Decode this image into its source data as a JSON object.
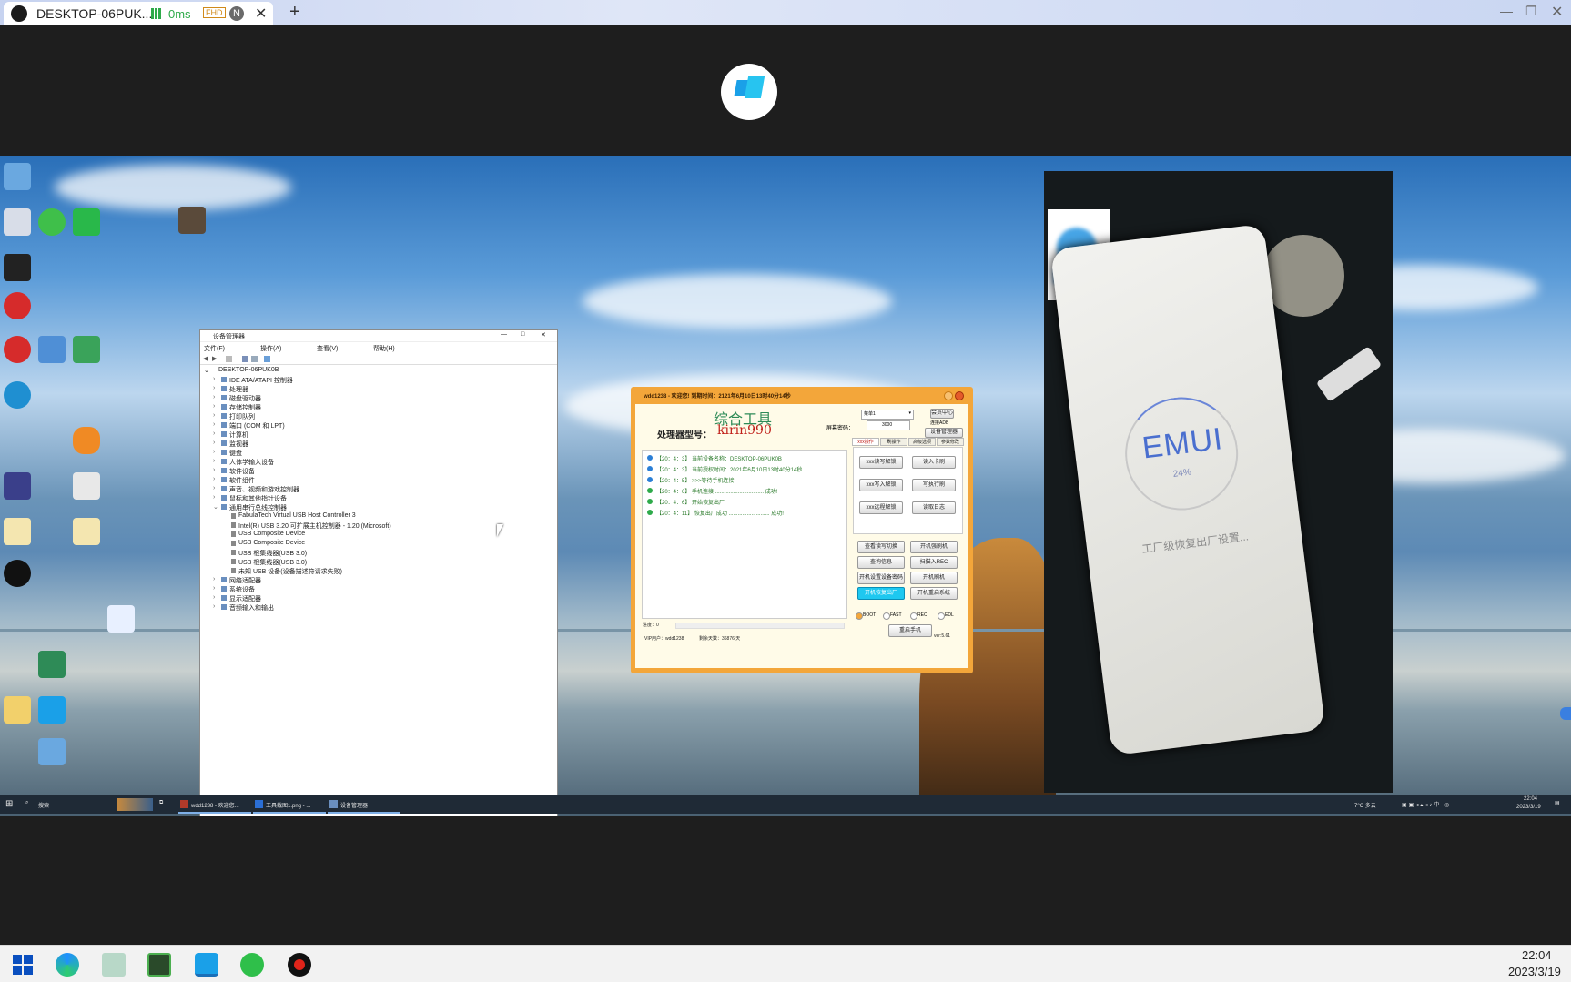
{
  "browser_tab": {
    "title": "DESKTOP-06PUK...",
    "latency": "0ms",
    "quality_badge": "FHD",
    "profile_initial": "N",
    "new_tab": "+"
  },
  "device_manager": {
    "title": "设备管理器",
    "menu": [
      "文件(F)",
      "操作(A)",
      "查看(V)",
      "帮助(H)"
    ],
    "root": "DESKTOP-06PUK0B",
    "tree": [
      "IDE ATA/ATAPI 控制器",
      "处理器",
      "磁盘驱动器",
      "存储控制器",
      "打印队列",
      "端口 (COM 和 LPT)",
      "计算机",
      "监视器",
      "键盘",
      "人体学输入设备",
      "软件设备",
      "软件组件",
      "声音、视频和游戏控制器",
      "鼠标和其他指针设备",
      "通用串行总线控制器"
    ],
    "usb_children": [
      "FabulaTech Virtual USB Host Controller 3",
      "Intel(R) USB 3.20 可扩展主机控制器 - 1.20 (Microsoft)",
      "USB Composite Device",
      "USB Composite Device",
      "USB 根集线器(USB 3.0)",
      "USB 根集线器(USB 3.0)",
      "未知 USB 设备(设备描述符请求失败)"
    ],
    "tree_after": [
      "网络适配器",
      "系统设备",
      "显示适配器",
      "音频输入和输出"
    ]
  },
  "tool": {
    "title": "wdd1238 - 欢迎您!  到期时间：2121年6月10日13时40分14秒",
    "heading": "综合工具",
    "cpu_label": "处理器型号：",
    "cpu_value": "kirin990",
    "dropdown": "菜单1",
    "key_label": "屏幕密码：",
    "key_value": "3000",
    "tabs": [
      "xxx操作",
      "刷操作",
      "高级选项",
      "参数修改"
    ],
    "top_buttons": [
      "会员中心",
      "连接ADB",
      "设备管理器"
    ],
    "log_lines": [
      "【20：4：3】 当前设备名称：DESKTOP-06PUK0B",
      "【20：4：3】 当前授权时间：2021年6月10日13时40分14秒",
      "【20：4：5】 >>>等待手机连接",
      "【20：4：6】 手机连接 ................................ 成功!",
      "【20：4：6】 开始恢复出厂",
      "【20：4：11】 恢复出厂成功 ........................... 成功!"
    ],
    "panel_buttons": [
      "xxx读写解锁",
      "读入卡刷",
      "xxx写入解锁",
      "写执行刷",
      "xxx远程解锁",
      "读取日志"
    ],
    "lower_buttons": [
      "查看读写切换",
      "开机强刷机",
      "查询信息",
      "扫描入REC",
      "开机设置设备密码",
      "开机刷机",
      "开机恢复出厂",
      "开机重启系统"
    ],
    "radios": [
      "BOOT",
      "FAST",
      "REC",
      "EDL"
    ],
    "bottom_button": "重启手机",
    "progress_label": "进度：0",
    "status_user": "VIP用户：wdd1238",
    "status_days": "剩余天数：36876 天",
    "version": "ver:5.61"
  },
  "phone": {
    "brand": "EMUI",
    "percent": "24%",
    "message": "工厂级恢复出厂设置..."
  },
  "inner_taskbar": {
    "search": "搜索",
    "apps": [
      "wdd1238 - 欢迎您...",
      "工具截图1.png - ...",
      "设备管理器"
    ],
    "weather": "7°C 多云",
    "time": "22:04",
    "date": "2023/3/19"
  },
  "host_taskbar": {
    "time": "22:04",
    "date": "2023/3/19"
  },
  "colors": {
    "tool_frame": "#f3a63a",
    "title_red": "#c0201a",
    "heading_green": "#2e8b57",
    "accent_blue": "#1e90ff",
    "host_taskbar": "#f2f2f2"
  }
}
